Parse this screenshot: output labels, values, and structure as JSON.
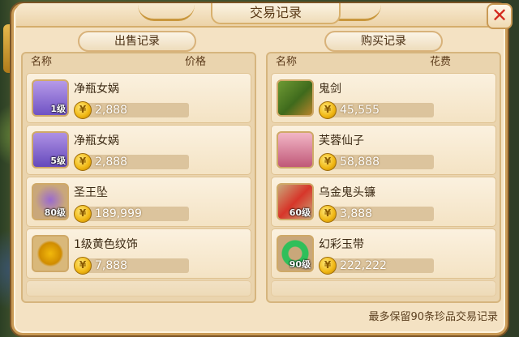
{
  "title": "交易记录",
  "close_symbol": "✕",
  "sell": {
    "tab_label": "出售记录",
    "header_name": "名称",
    "header_value": "价格",
    "items": [
      {
        "name": "净瓶女娲",
        "level": "1级",
        "price": "2,888",
        "icon": "nuwa-portrait-icon",
        "thumb_color": "#8a6ad6"
      },
      {
        "name": "净瓶女娲",
        "level": "5级",
        "price": "2,888",
        "icon": "nuwa-portrait-icon",
        "thumb_color": "#7f62cf"
      },
      {
        "name": "圣王坠",
        "level": "80级",
        "price": "189,999",
        "icon": "pendant-icon",
        "thumb_color": "#c9a77a"
      },
      {
        "name": "1级黄色纹饰",
        "level": "",
        "price": "7,888",
        "icon": "yellow-gem-icon",
        "thumb_color": "#d9b87a"
      }
    ]
  },
  "buy": {
    "tab_label": "购买记录",
    "header_name": "名称",
    "header_value": "花费",
    "items": [
      {
        "name": "鬼剑",
        "level": "",
        "price": "45,555",
        "icon": "ghost-sword-icon",
        "thumb_color": "#5e8a2e"
      },
      {
        "name": "芙蓉仙子",
        "level": "",
        "price": "58,888",
        "icon": "fairy-portrait-icon",
        "thumb_color": "#d98aa0"
      },
      {
        "name": "乌金鬼头镰",
        "level": "60级",
        "price": "3,888",
        "icon": "scythe-icon",
        "thumb_color": "#c9a77a"
      },
      {
        "name": "幻彩玉带",
        "level": "90级",
        "price": "222,222",
        "icon": "jade-belt-icon",
        "thumb_color": "#c9a77a"
      }
    ]
  },
  "footer_note": "最多保留90条珍品交易记录",
  "colors": {
    "panel": "#f4e2c3",
    "border": "#c99a55",
    "close": "#d4291e",
    "coin": "#f0b613"
  }
}
